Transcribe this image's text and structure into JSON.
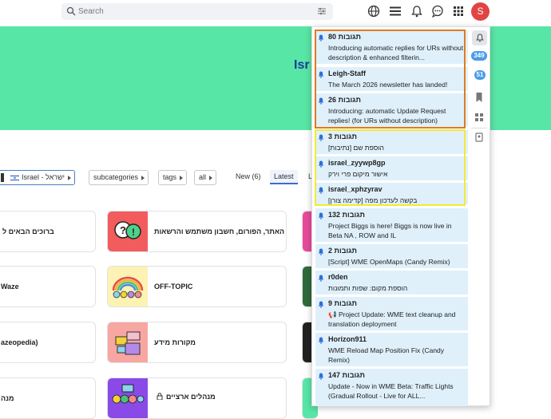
{
  "search": {
    "placeholder": "Search"
  },
  "header": {
    "avatar_letter": "S"
  },
  "banner": {
    "title": "Isr"
  },
  "filters": {
    "category": "Israel - ישראל",
    "subcategories": "subcategories",
    "tags": "tags",
    "all": "all"
  },
  "nav": {
    "new": "New (6)",
    "latest": "Latest",
    "partial": "L"
  },
  "cards": [
    {
      "text": "ברוכים הבאים ל"
    },
    {
      "text": "האתר, הפורום, חשבון משתמש והרשאות"
    },
    {
      "text": "Waze"
    },
    {
      "text": "OFF-TOPIC"
    },
    {
      "text": "azeopedia)"
    },
    {
      "text": "מקורות מידע"
    },
    {
      "text": "מנה"
    },
    {
      "text": "מנהלים ארציים"
    }
  ],
  "sidebar": {
    "badge1": "349",
    "badge2": "51"
  },
  "notifications": [
    {
      "title": "תגובות 80",
      "body": "Introducing automatic replies for URs without description & enhanced filterin..."
    },
    {
      "title": "Leigh-Staff",
      "body": "The March 2026 newsletter has landed!"
    },
    {
      "title": "תגובות 26",
      "body": "Introducing: automatic Update Request replies! (for URs without description)"
    },
    {
      "title": "תגובות 3",
      "body": "הוספת שם [נתיבות]"
    },
    {
      "title": "israel_zyywp8gp",
      "body": "אישור מיקום פרי וירק"
    },
    {
      "title": "israel_xphzyrav",
      "body": "בקשה לעדכון מפה [קדימה צורן]"
    },
    {
      "title": "תגובות 132",
      "body": "Project Biggs is here! Biggs is now live in Beta NA , ROW and IL"
    },
    {
      "title": "תגובות 2",
      "body": "[Script] WME OpenMaps (Candy Remix)"
    },
    {
      "title": "r0den",
      "body": "הוספת מקום: שפות ותמונות"
    },
    {
      "title": "תגובות 9",
      "body": "📢 Project Update: WME text cleanup and translation deployment"
    },
    {
      "title": "Horizon911",
      "body": "WME Reload Map Position Fix (Candy Remix)"
    },
    {
      "title": "תגובות 147",
      "body": "Update - Now in WME Beta: Traffic Lights (Gradual Rollout - Live for ALL..."
    }
  ],
  "colors": {
    "banner": "#58e6a6",
    "accent": "#3b6bd4",
    "highlight_orange": "#e07a1f",
    "highlight_yellow": "#f2ea36",
    "notif_bg": "#dff0fb"
  }
}
